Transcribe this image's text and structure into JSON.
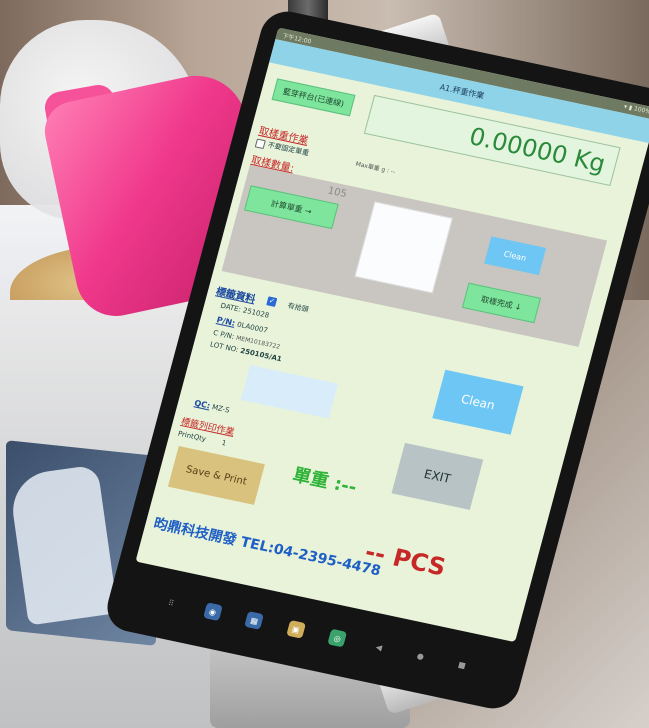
{
  "app": {
    "status_time": "下午12:00",
    "status_right": "▾ ▮ 100%",
    "title": "A1.秤重作業"
  },
  "top": {
    "connect_button": "藍芽秤台(已連線)",
    "weight_value": "0.00000 Kg"
  },
  "unit_calc": {
    "section_label": "取樣重作業",
    "fixed_sample_label": "不要固定單重",
    "max_label": "Max單重 g : --",
    "sample_qty_label": "取樣數量:",
    "sample_qty_value": "105",
    "calc_button": "計算單重 →",
    "clean_button": "Clean",
    "done_button": "取樣完成 ↓"
  },
  "label_info": {
    "section_label": "標籤資料",
    "has_label_text": "有拾頭",
    "date_label": "DATE",
    "date_value": "251028",
    "pn_label": "P/N:",
    "pn_value": "0LA0007",
    "cpn_label": "C P/N:",
    "cpn_value": "MEM10183722",
    "lot_label": "LOT NO:",
    "lot_value": "250105/A1",
    "qc_label": "QC:",
    "qc_value": "MZ-S",
    "clean_button": "Clean",
    "exit_button": "EXIT"
  },
  "print": {
    "section_label": "標籤列印作業",
    "qty_label": "PrintQty",
    "qty_value": "1",
    "save_print_button": "Save & Print",
    "unit_weight_label": "單重 :--",
    "pcs_label": "-- PCS"
  },
  "footer": {
    "company": "昀鼎科技開發  TEL:04-2395-4478"
  },
  "navbar": {
    "apps_icon": "apps-icon",
    "back_icon": "back-icon",
    "home_icon": "home-icon",
    "recent_icon": "recent-icon"
  },
  "stand_tag": "C",
  "colors": {
    "screen_bg": "#e8f3d9",
    "appbar": "#8fd3e8",
    "weight_green": "#2a8a3a",
    "pcs_red": "#c62828",
    "company_blue": "#1e5fc6"
  }
}
